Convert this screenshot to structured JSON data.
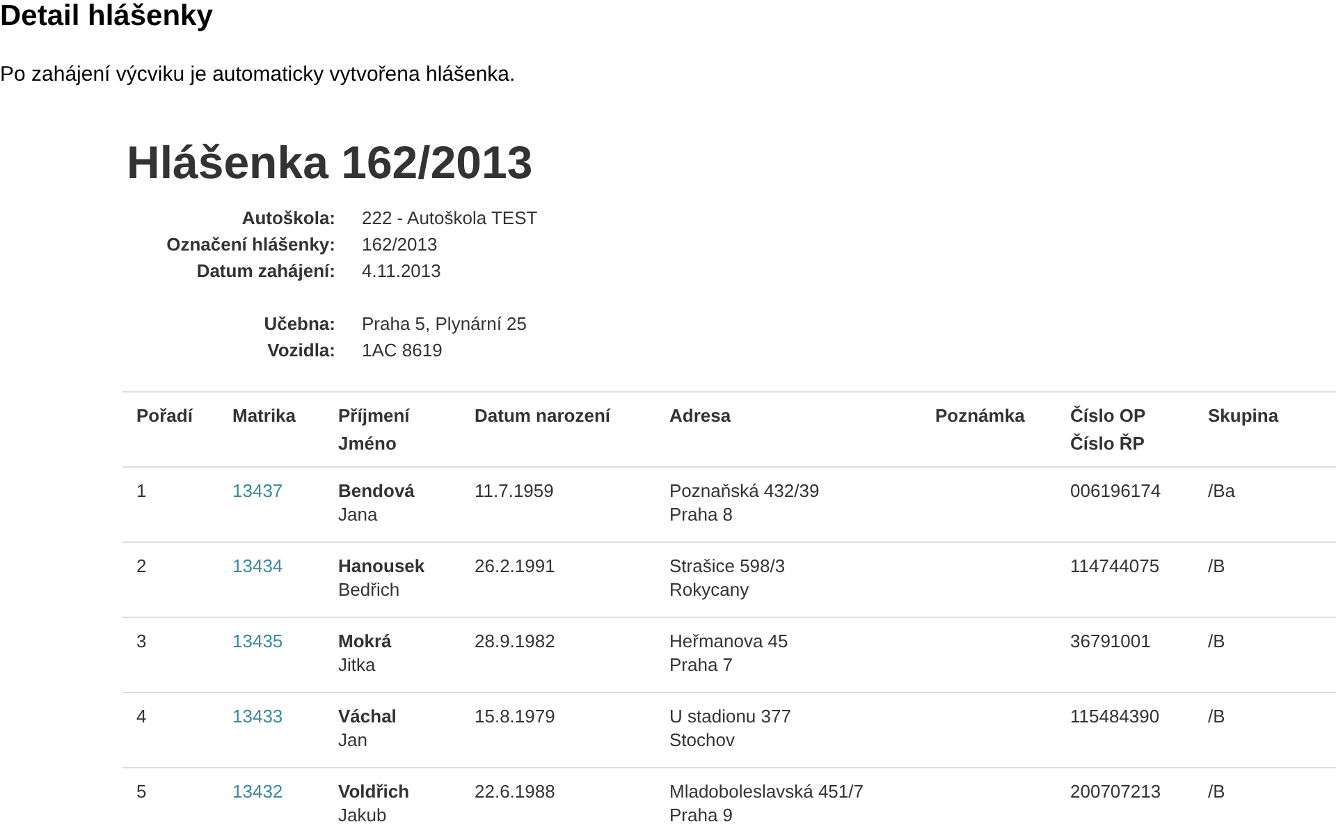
{
  "document": {
    "heading": "Detail hlášenky",
    "intro": "Po zahájení výcviku je automaticky vytvořena hlášenka."
  },
  "report": {
    "title": "Hlášenka 162/2013",
    "details": [
      {
        "label": "Autoškola:",
        "value": "222 - Autoškola TEST"
      },
      {
        "label": "Označení hlášenky:",
        "value": "162/2013"
      },
      {
        "label": "Datum zahájení:",
        "value": "4.11.2013"
      }
    ],
    "resources": [
      {
        "label": "Učebna:",
        "value": "Praha 5, Plynární 25"
      },
      {
        "label": "Vozidla:",
        "value": "1AC 8619"
      }
    ],
    "table": {
      "columns": [
        [
          "Pořadí"
        ],
        [
          "Matrika"
        ],
        [
          "Příjmení",
          "Jméno"
        ],
        [
          "Datum narození"
        ],
        [
          "Adresa"
        ],
        [
          "Poznámka"
        ],
        [
          "Číslo OP",
          "Číslo ŘP"
        ],
        [
          "Skupina"
        ]
      ],
      "rows": [
        {
          "order": "1",
          "register": "13437",
          "surname": "Bendová",
          "first_name": "Jana",
          "birth_date": "11.7.1959",
          "street": "Poznaňská 432/39",
          "city": "Praha 8",
          "id_number": "006196174",
          "group": "/Ba"
        },
        {
          "order": "2",
          "register": "13434",
          "surname": "Hanousek",
          "first_name": "Bedřich",
          "birth_date": "26.2.1991",
          "street": "Strašice 598/3",
          "city": "Rokycany",
          "id_number": "114744075",
          "group": "/B"
        },
        {
          "order": "3",
          "register": "13435",
          "surname": "Mokrá",
          "first_name": "Jitka",
          "birth_date": "28.9.1982",
          "street": "Heřmanova 45",
          "city": "Praha 7",
          "id_number": "36791001",
          "group": "/B"
        },
        {
          "order": "4",
          "register": "13433",
          "surname": "Váchal",
          "first_name": "Jan",
          "birth_date": "15.8.1979",
          "street": "U stadionu 377",
          "city": "Stochov",
          "id_number": "115484390",
          "group": "/B"
        },
        {
          "order": "5",
          "register": "13432",
          "surname": "Voldřich",
          "first_name": "Jakub",
          "birth_date": "22.6.1988",
          "street": "Mladoboleslavská 451/7",
          "city": "Praha 9",
          "id_number": "200707213",
          "group": "/B"
        }
      ]
    }
  }
}
